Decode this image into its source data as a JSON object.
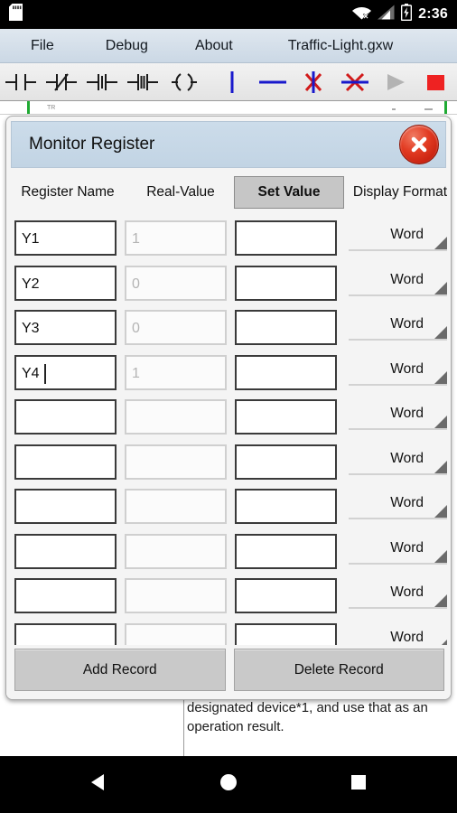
{
  "statusbar": {
    "sdcard_icon": "sdcard-icon",
    "wifi_icon": "wifi-off-icon",
    "signal_icon": "cellular-signal-icon",
    "battery_icon": "battery-charging-icon",
    "time": "2:36"
  },
  "menubar": {
    "items": [
      {
        "label": "File",
        "name": "menu-file"
      },
      {
        "label": "Debug",
        "name": "menu-debug"
      },
      {
        "label": "About",
        "name": "menu-about"
      }
    ],
    "document_title": "Traffic-Light.gxw"
  },
  "toolbar": {
    "buttons": [
      {
        "name": "no-contact-icon",
        "title": "Normally Open Contact"
      },
      {
        "name": "nc-contact-icon",
        "title": "Normally Closed Contact"
      },
      {
        "name": "rising-pulse-icon",
        "title": "Rising Pulse Contact"
      },
      {
        "name": "falling-pulse-icon",
        "title": "Falling Pulse Contact"
      },
      {
        "name": "coil-icon",
        "title": "Output Coil"
      },
      {
        "name": "vertical-line-icon",
        "title": "Vertical Line"
      },
      {
        "name": "horizontal-line-icon",
        "title": "Horizontal Line"
      },
      {
        "name": "delete-vertical-icon",
        "title": "Delete Vertical Line"
      },
      {
        "name": "delete-horizontal-icon",
        "title": "Delete Horizontal Line"
      },
      {
        "name": "run-icon",
        "title": "Run"
      },
      {
        "name": "stop-icon",
        "title": "Stop"
      }
    ]
  },
  "canvas": {
    "tick_label": "TR",
    "doc_text": "designated device*1, and use that as an operation result."
  },
  "dialog": {
    "title": "Monitor Register",
    "close_icon": "close-icon",
    "columns": {
      "register_name": "Register Name",
      "real_value": "Real-Value",
      "set_value": "Set Value",
      "display_format": "Display Format"
    },
    "rows": [
      {
        "register_name": "Y1",
        "real_value": "1",
        "set_value": "",
        "display_format": "Word",
        "caret": false
      },
      {
        "register_name": "Y2",
        "real_value": "0",
        "set_value": "",
        "display_format": "Word",
        "caret": false
      },
      {
        "register_name": "Y3",
        "real_value": "0",
        "set_value": "",
        "display_format": "Word",
        "caret": false
      },
      {
        "register_name": "Y4",
        "real_value": "1",
        "set_value": "",
        "display_format": "Word",
        "caret": true
      },
      {
        "register_name": "",
        "real_value": "",
        "set_value": "",
        "display_format": "Word",
        "caret": false
      },
      {
        "register_name": "",
        "real_value": "",
        "set_value": "",
        "display_format": "Word",
        "caret": false
      },
      {
        "register_name": "",
        "real_value": "",
        "set_value": "",
        "display_format": "Word",
        "caret": false
      },
      {
        "register_name": "",
        "real_value": "",
        "set_value": "",
        "display_format": "Word",
        "caret": false
      },
      {
        "register_name": "",
        "real_value": "",
        "set_value": "",
        "display_format": "Word",
        "caret": false
      },
      {
        "register_name": "",
        "real_value": "",
        "set_value": "",
        "display_format": "Word",
        "caret": false
      }
    ],
    "buttons": {
      "add_record": "Add Record",
      "delete_record": "Delete Record"
    }
  },
  "navbar": {
    "back_icon": "back-triangle-icon",
    "home_icon": "home-circle-icon",
    "recents_icon": "recents-square-icon"
  },
  "colors": {
    "accent_blue": "#c2d4e4",
    "close_red": "#e23b22",
    "stop_red": "#ee2222",
    "rail_green": "#1faa33",
    "toolbar_blue": "#1919cc"
  }
}
